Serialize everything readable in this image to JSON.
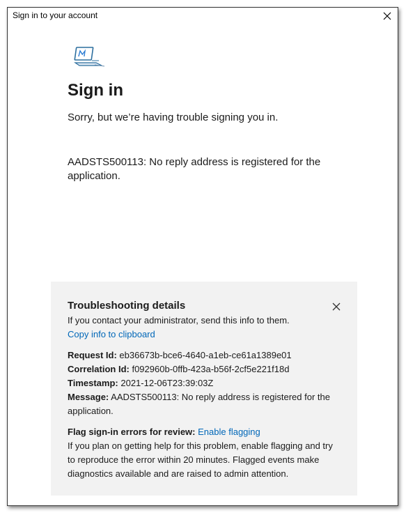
{
  "window": {
    "title": "Sign in to your account"
  },
  "main": {
    "heading": "Sign in",
    "subtext": "Sorry, but we’re having trouble signing you in.",
    "error_message": "AADSTS500113: No reply address is registered for the application."
  },
  "troubleshooting": {
    "title": "Troubleshooting details",
    "intro": "If you contact your administrator, send this info to them.",
    "copy_link": "Copy info to clipboard",
    "request_id_label": "Request Id:",
    "request_id": "eb36673b-bce6-4640-a1eb-ce61a1389e01",
    "correlation_id_label": "Correlation Id:",
    "correlation_id": "f092960b-0ffb-423a-b56f-2cf5e221f18d",
    "timestamp_label": "Timestamp:",
    "timestamp": "2021-12-06T23:39:03Z",
    "message_label": "Message:",
    "message": "AADSTS500113: No reply address is registered for the application.",
    "flag_label": "Flag sign-in errors for review:",
    "flag_link": "Enable flagging",
    "flag_description": "If you plan on getting help for this problem, enable flagging and try to reproduce the error within 20 minutes. Flagged events make diagnostics available and are raised to admin attention."
  },
  "colors": {
    "link": "#0067b8",
    "panel_background": "#f2f2f2",
    "text": "#1b1b1b"
  },
  "icons": {
    "window_close": "close-icon",
    "logo": "laptop-logo-icon",
    "panel_close": "close-icon"
  }
}
